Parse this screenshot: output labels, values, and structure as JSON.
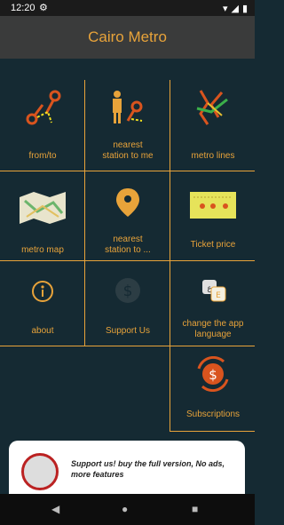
{
  "status": {
    "time": "12:20"
  },
  "app": {
    "title": "Cairo Metro"
  },
  "grid": {
    "from_to": "from/to",
    "nearest_me": "nearest\nstation to me",
    "metro_lines": "metro lines",
    "metro_map": "metro map",
    "nearest_to": "nearest\nstation to ...",
    "ticket_price": "Ticket price",
    "about": "about",
    "support_us": "Support Us",
    "change_language": "change the app\nlanguage",
    "subscriptions": "Subscriptions"
  },
  "ad": {
    "text": "Support us! buy the full version, No ads, more features"
  },
  "colors": {
    "accent": "#e8a33a",
    "background": "#152a33",
    "appbar": "#3a3b3b"
  }
}
